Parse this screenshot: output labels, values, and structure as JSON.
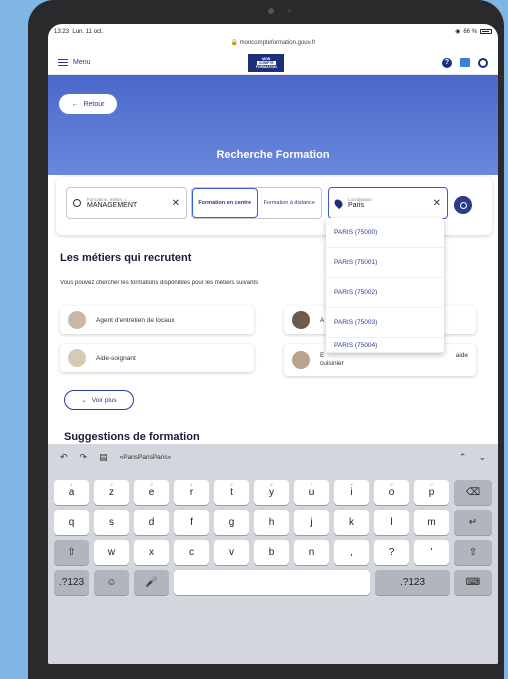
{
  "status": {
    "time": "13:23",
    "date": "Lun. 11 oct.",
    "battery": "66 %"
  },
  "browser": {
    "url": "moncompteformation.gouv.fr"
  },
  "app": {
    "menu_label": "Menu",
    "logo_lines": [
      "MON",
      "COMPTE",
      "FORMATION"
    ]
  },
  "hero": {
    "back_label": "Retour",
    "title": "Recherche Formation"
  },
  "search": {
    "keyword_label": "Formation, métier, c...",
    "keyword_value": "MANAGEMENT",
    "toggle": [
      {
        "label": "Formation en centre",
        "active": true
      },
      {
        "label": "Formation à distance",
        "active": false
      }
    ],
    "location_label": "Localisation",
    "location_value": "Paris"
  },
  "dropdown": [
    "PARIS (75000)",
    "PARIS (75001)",
    "PARIS (75002)",
    "PARIS (75003)",
    "PARIS (75004)"
  ],
  "jobs": {
    "title": "Les métiers qui recrutent",
    "subtitle": "Vous pouvez chercher les formations disponibles pour les métiers suivants",
    "items": [
      "Agent d'entretien de locaux",
      "A",
      "Aide-soignant",
      "E",
      "aide",
      "cuisinier"
    ],
    "more_label": "Voir plus"
  },
  "suggestions_title": "Suggestions de formation",
  "keyboard": {
    "suggestion": "«ParisParisParis»",
    "row1": [
      "a",
      "z",
      "e",
      "r",
      "t",
      "y",
      "u",
      "i",
      "o",
      "p"
    ],
    "row1_hints": [
      "1",
      "2",
      "3",
      "4",
      "5",
      "6",
      "7",
      "8",
      "9",
      "0"
    ],
    "row2": [
      "q",
      "s",
      "d",
      "f",
      "g",
      "h",
      "j",
      "k",
      "l",
      "m"
    ],
    "row3": [
      "w",
      "x",
      "c",
      "v",
      "b",
      "n",
      ",",
      "?",
      "'"
    ],
    "row3_extra": [
      ".",
      "!"
    ],
    "num_label": ".?123"
  }
}
